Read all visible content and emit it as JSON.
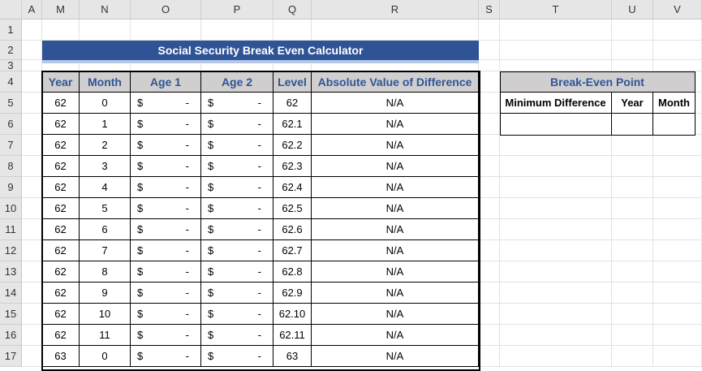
{
  "columns": [
    "A",
    "M",
    "N",
    "O",
    "P",
    "Q",
    "R",
    "S",
    "T",
    "U",
    "V"
  ],
  "rows": [
    "1",
    "2",
    "3",
    "4",
    "5",
    "6",
    "7",
    "8",
    "9",
    "10",
    "11",
    "12",
    "13",
    "14",
    "15",
    "16",
    "17"
  ],
  "title": "Social Security Break Even Calculator",
  "table": {
    "headers": [
      "Year",
      "Month",
      "Age 1",
      "Age 2",
      "Level",
      "Absolute Value of Difference"
    ],
    "rows": [
      [
        "62",
        "0",
        "$",
        "-",
        "$",
        "-",
        "62",
        "N/A"
      ],
      [
        "62",
        "1",
        "$",
        "-",
        "$",
        "-",
        "62.1",
        "N/A"
      ],
      [
        "62",
        "2",
        "$",
        "-",
        "$",
        "-",
        "62.2",
        "N/A"
      ],
      [
        "62",
        "3",
        "$",
        "-",
        "$",
        "-",
        "62.3",
        "N/A"
      ],
      [
        "62",
        "4",
        "$",
        "-",
        "$",
        "-",
        "62.4",
        "N/A"
      ],
      [
        "62",
        "5",
        "$",
        "-",
        "$",
        "-",
        "62.5",
        "N/A"
      ],
      [
        "62",
        "6",
        "$",
        "-",
        "$",
        "-",
        "62.6",
        "N/A"
      ],
      [
        "62",
        "7",
        "$",
        "-",
        "$",
        "-",
        "62.7",
        "N/A"
      ],
      [
        "62",
        "8",
        "$",
        "-",
        "$",
        "-",
        "62.8",
        "N/A"
      ],
      [
        "62",
        "9",
        "$",
        "-",
        "$",
        "-",
        "62.9",
        "N/A"
      ],
      [
        "62",
        "10",
        "$",
        "-",
        "$",
        "-",
        "62.10",
        "N/A"
      ],
      [
        "62",
        "11",
        "$",
        "-",
        "$",
        "-",
        "62.11",
        "N/A"
      ],
      [
        "63",
        "0",
        "$",
        "-",
        "$",
        "-",
        "63",
        "N/A"
      ]
    ]
  },
  "breakeven": {
    "title": "Break-Even Point",
    "headers": [
      "Minimum Difference",
      "Year",
      "Month"
    ],
    "values": [
      "",
      "",
      ""
    ]
  },
  "colors": {
    "title_bg": "#2f5496",
    "header_bg": "#d0cece",
    "header_text": "#2f5597"
  }
}
